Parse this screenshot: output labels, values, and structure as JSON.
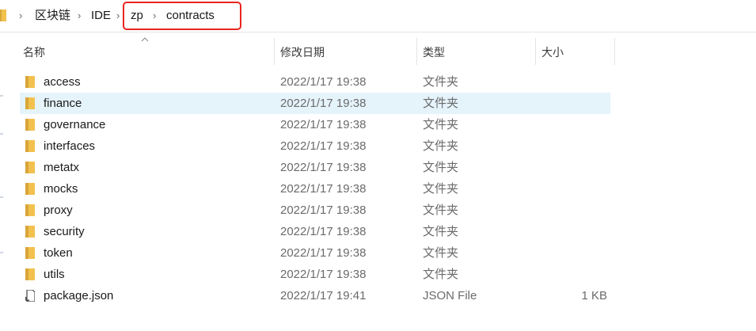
{
  "breadcrumb": {
    "items": [
      "区块链",
      "IDE",
      "zp",
      "contracts"
    ],
    "chevron": "›"
  },
  "columns": {
    "name": "名称",
    "modified": "修改日期",
    "type": "类型",
    "size": "大小"
  },
  "files": [
    {
      "name": "access",
      "date": "2022/1/17 19:38",
      "type": "文件夹",
      "size": "",
      "icon": "folder-icon"
    },
    {
      "name": "finance",
      "date": "2022/1/17 19:38",
      "type": "文件夹",
      "size": "",
      "icon": "folder-icon"
    },
    {
      "name": "governance",
      "date": "2022/1/17 19:38",
      "type": "文件夹",
      "size": "",
      "icon": "folder-icon"
    },
    {
      "name": "interfaces",
      "date": "2022/1/17 19:38",
      "type": "文件夹",
      "size": "",
      "icon": "folder-icon"
    },
    {
      "name": "metatx",
      "date": "2022/1/17 19:38",
      "type": "文件夹",
      "size": "",
      "icon": "folder-icon"
    },
    {
      "name": "mocks",
      "date": "2022/1/17 19:38",
      "type": "文件夹",
      "size": "",
      "icon": "folder-icon"
    },
    {
      "name": "proxy",
      "date": "2022/1/17 19:38",
      "type": "文件夹",
      "size": "",
      "icon": "folder-icon"
    },
    {
      "name": "security",
      "date": "2022/1/17 19:38",
      "type": "文件夹",
      "size": "",
      "icon": "folder-icon"
    },
    {
      "name": "token",
      "date": "2022/1/17 19:38",
      "type": "文件夹",
      "size": "",
      "icon": "folder-icon"
    },
    {
      "name": "utils",
      "date": "2022/1/17 19:38",
      "type": "文件夹",
      "size": "",
      "icon": "folder-icon"
    },
    {
      "name": "package.json",
      "date": "2022/1/17 19:41",
      "type": "JSON File",
      "size": "1 KB",
      "icon": "json-file-icon"
    }
  ],
  "selected_row": "finance",
  "colors": {
    "highlight_box": "#e8261f",
    "selection": "#e5f3fb",
    "folder": "#f2c14e"
  }
}
